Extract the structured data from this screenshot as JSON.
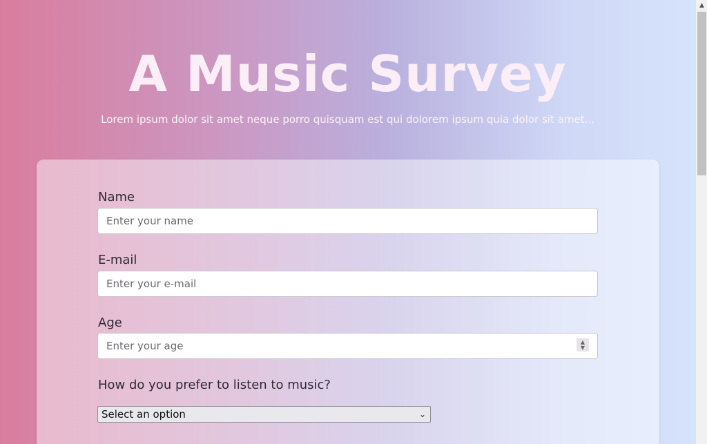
{
  "header": {
    "title": "A Music Survey",
    "subtitle": "Lorem ipsum dolor sit amet neque porro quisquam est qui dolorem ipsum quia dolor sit amet..."
  },
  "form": {
    "name": {
      "label": "Name",
      "placeholder": "Enter your name"
    },
    "email": {
      "label": "E-mail",
      "placeholder": "Enter your e-mail"
    },
    "age": {
      "label": "Age",
      "placeholder": "Enter your age"
    },
    "listen": {
      "question": "How do you prefer to listen to music?",
      "selected": "Select an option"
    }
  },
  "icons": {
    "spinner_up": "▲",
    "spinner_down": "▼",
    "select_chevron": "⌄",
    "scroll_up": "▲"
  },
  "colors": {
    "gradient_left": "#d97d9e",
    "gradient_right": "#d7e4fc",
    "title_text": "#fbeef6"
  }
}
